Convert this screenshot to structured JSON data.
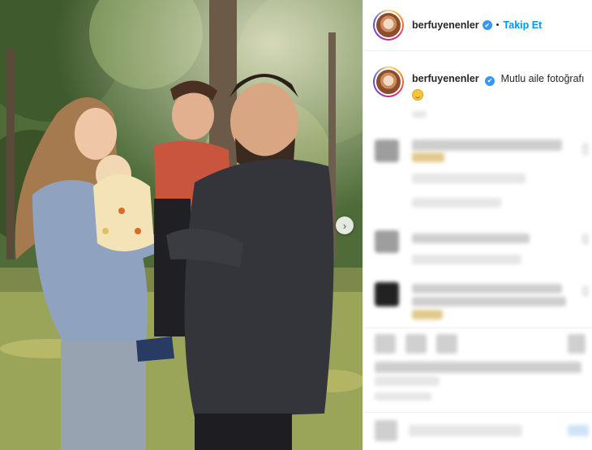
{
  "post": {
    "username": "berfuyenenler",
    "follow_label": "Takip Et",
    "separator": "•",
    "caption": "Mutlu aile fotoğrafı",
    "verified_icon": "✔"
  },
  "photo": {
    "next_icon": "›"
  },
  "colors": {
    "link_blue": "#0095f6",
    "verified_blue": "#3897f0"
  }
}
